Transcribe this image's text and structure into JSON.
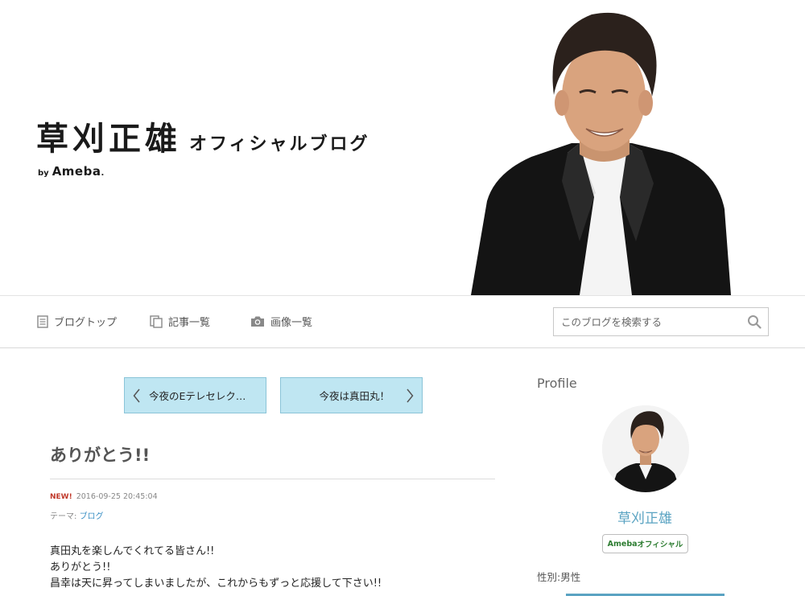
{
  "header": {
    "title_main": "草刈正雄",
    "title_sub": "オフィシャルブログ",
    "by": "by",
    "brand": "Ameba",
    "brand_dot": "."
  },
  "nav": {
    "items": [
      {
        "label": "ブログトップ",
        "icon": "document-icon"
      },
      {
        "label": "記事一覧",
        "icon": "copy-icon"
      },
      {
        "label": "画像一覧",
        "icon": "camera-icon"
      }
    ],
    "search": {
      "placeholder": "このブログを検索する",
      "icon": "search-icon"
    }
  },
  "pager": {
    "prev_label": "今夜のEテレセレク…",
    "next_label": "今夜は真田丸！"
  },
  "article": {
    "title": "ありがとう!!",
    "new_badge": "NEW!",
    "timestamp": "2016-09-25 20:45:04",
    "theme_label": "テーマ:",
    "theme_value": "ブログ",
    "body": [
      "真田丸を楽しんでくれてる皆さん!!",
      "ありがとう!!",
      "昌幸は天に昇ってしまいましたが、これからもずっと応援して下さい!!"
    ]
  },
  "sidebar": {
    "heading": "Profile",
    "name": "草刈正雄",
    "badge_brand": "Ameba",
    "badge_text": "オフィシャル",
    "gender": "性別:男性"
  },
  "colors": {
    "pager_bg": "#bfe6f2",
    "pager_border": "#8ac4d8",
    "link_blue": "#3a8fc4",
    "name_blue": "#5aa3c2",
    "new_red": "#c0392b",
    "badge_green": "#2e7d32"
  }
}
